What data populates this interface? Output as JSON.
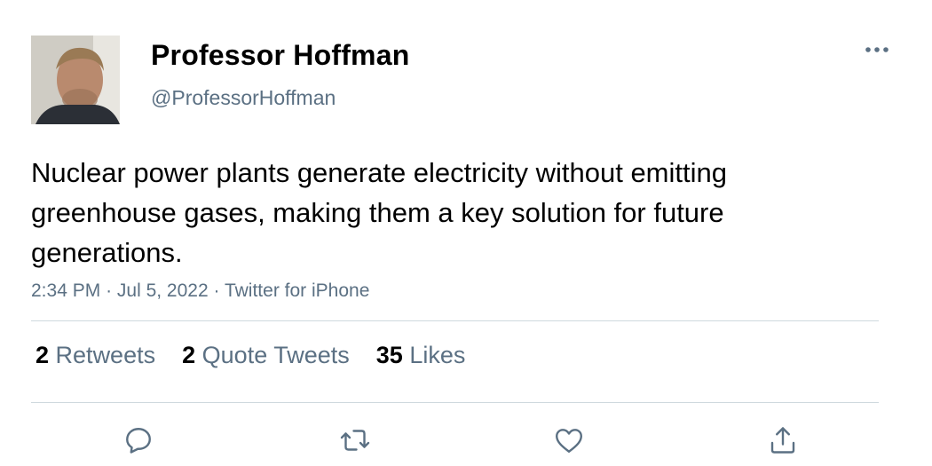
{
  "author": {
    "name": "Professor Hoffman",
    "handle": "@ProfessorHoffman"
  },
  "tweet": {
    "text": "Nuclear power plants generate electricity without emitting greenhouse gases, making them a key solution for future generations.",
    "time": "2:34 PM",
    "date": "Jul 5, 2022",
    "source": "Twitter for iPhone",
    "separator": "·"
  },
  "stats": {
    "retweets_count": "2",
    "retweets_label": "Retweets",
    "quotes_count": "2",
    "quotes_label": "Quote Tweets",
    "likes_count": "35",
    "likes_label": "Likes"
  },
  "icons": {
    "more": "more-horizontal-icon",
    "reply": "comment-icon",
    "retweet": "retweet-icon",
    "like": "heart-icon",
    "share": "share-icon"
  },
  "colors": {
    "secondary_text": "#5b7083",
    "divider": "#cfd9de",
    "primary_text": "#000000"
  }
}
